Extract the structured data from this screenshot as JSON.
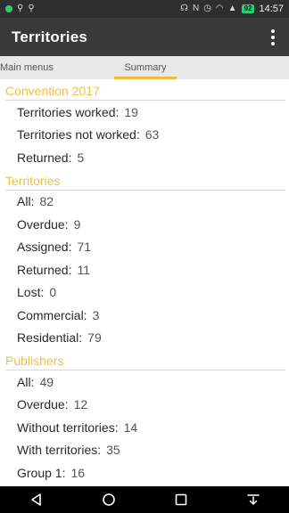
{
  "status_bar": {
    "icons_left": [
      "notification-dot-icon",
      "usb-icon",
      "usb-icon"
    ],
    "icons_right": [
      "headset-icon",
      "nfc-icon",
      "alarm-icon",
      "wifi-icon",
      "signal-icon"
    ],
    "battery": "92",
    "time": "14:57",
    "accent_color": "#2ecc71"
  },
  "app_bar": {
    "title": "Territories",
    "menu_icon": "more-vert-icon"
  },
  "tabs": [
    {
      "label": "Main menus",
      "selected": false
    },
    {
      "label": "Summary",
      "selected": true
    }
  ],
  "tab_indicator_color": "#f5b82e",
  "section_color": "#f0c040",
  "sections": [
    {
      "title": "Convention 2017",
      "rows": [
        {
          "label": "Territories worked:",
          "value": "19"
        },
        {
          "label": "Territories not worked:",
          "value": "63"
        },
        {
          "label": "Returned:",
          "value": "5"
        }
      ]
    },
    {
      "title": "Territories",
      "rows": [
        {
          "label": "All:",
          "value": "82"
        },
        {
          "label": "Overdue:",
          "value": "9"
        },
        {
          "label": "Assigned:",
          "value": "71"
        },
        {
          "label": "Returned:",
          "value": "11"
        },
        {
          "label": "Lost:",
          "value": "0"
        },
        {
          "label": "Commercial:",
          "value": "3"
        },
        {
          "label": "Residential:",
          "value": "79"
        }
      ]
    },
    {
      "title": "Publishers",
      "rows": [
        {
          "label": "All:",
          "value": "49"
        },
        {
          "label": "Overdue:",
          "value": "12"
        },
        {
          "label": "Without territories:",
          "value": "14"
        },
        {
          "label": "With territories:",
          "value": "35"
        },
        {
          "label": "Group 1:",
          "value": "16"
        }
      ]
    }
  ],
  "nav_bar": {
    "icons": [
      "back-icon",
      "home-icon",
      "recents-icon",
      "notifications-pull-icon"
    ]
  }
}
